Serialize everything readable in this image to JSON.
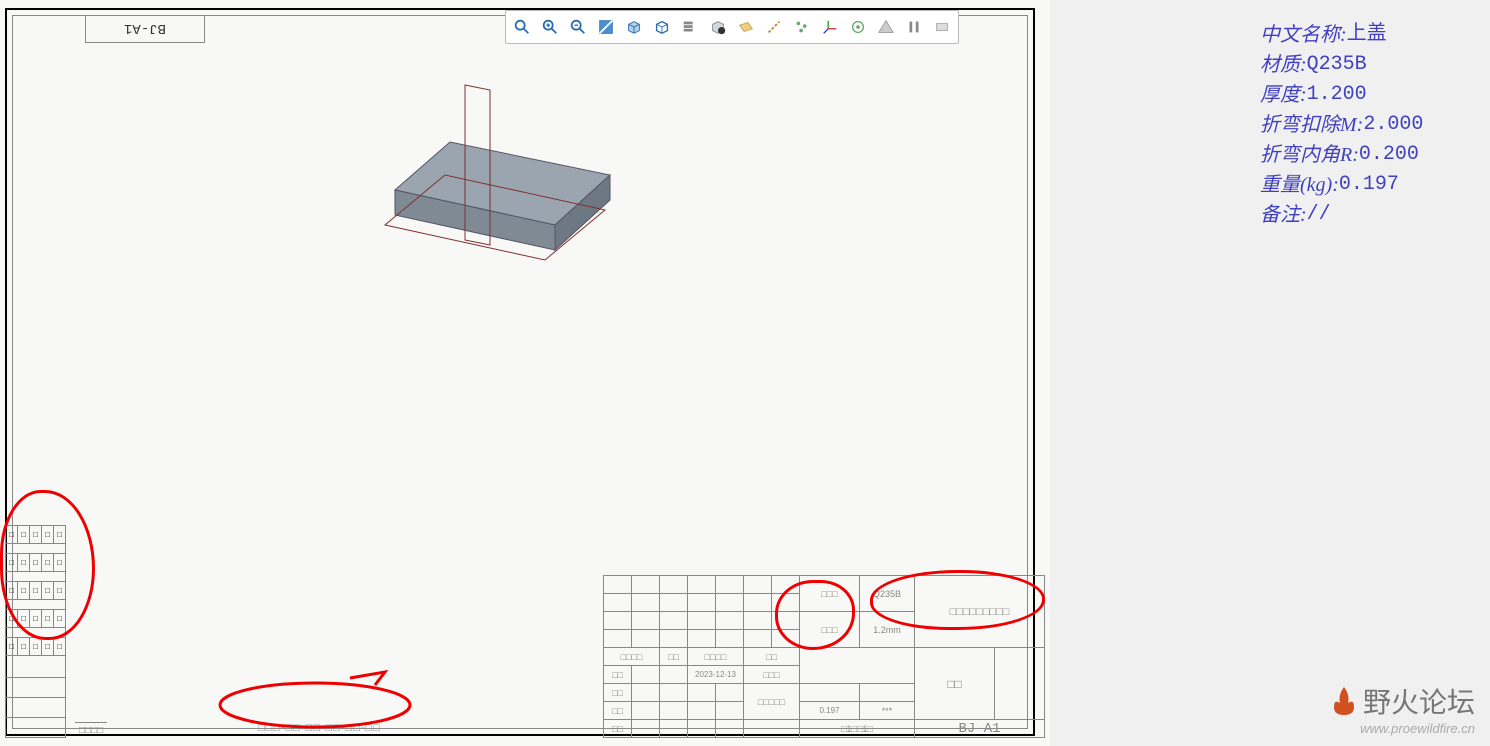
{
  "part_label": "BJ-A1",
  "info": {
    "name_label": "中文名称:",
    "name_value": " 上盖",
    "material_label": "材质:",
    "material_value": "Q235B",
    "thickness_label": "厚度:",
    "thickness_value": "1.200",
    "bend_deduct_label": "折弯扣除M:",
    "bend_deduct_value": "2.000",
    "bend_radius_label": "折弯内角R:",
    "bend_radius_value": "0.200",
    "weight_label": "重量(kg):",
    "weight_value": "0.197",
    "remark_label": "备注:",
    "remark_value": "//"
  },
  "title_block": {
    "material": "Q235B",
    "thickness": "1.2mm",
    "date": "2023-12-13",
    "mass": "0.197",
    "mass_unit": "***",
    "part_no": "BJ-A1",
    "scale": "□1□□1□",
    "boxes3": "□□□",
    "boxes2": "□□",
    "boxes4": "□□□□",
    "boxes5": "□□□□□",
    "boxes6": "□□□□□□",
    "boxes9": "□□□□□□□□□",
    "code": "□□□-□□-□□-□□-□□-□□"
  },
  "watermark": {
    "cn": "野火论坛",
    "url": "www.proewildfire.cn"
  },
  "toolbar_icons": [
    "zoom-fit-icon",
    "zoom-in-icon",
    "zoom-out-icon",
    "repaint-icon",
    "shading-icon",
    "no-hidden-icon",
    "layers-icon",
    "saved-views-icon",
    "annotation-icon",
    "datum-axis-icon",
    "datum-point-icon",
    "datum-csys-icon",
    "spin-center-icon",
    "warning-icon",
    "pause-icon",
    "stop-icon"
  ]
}
